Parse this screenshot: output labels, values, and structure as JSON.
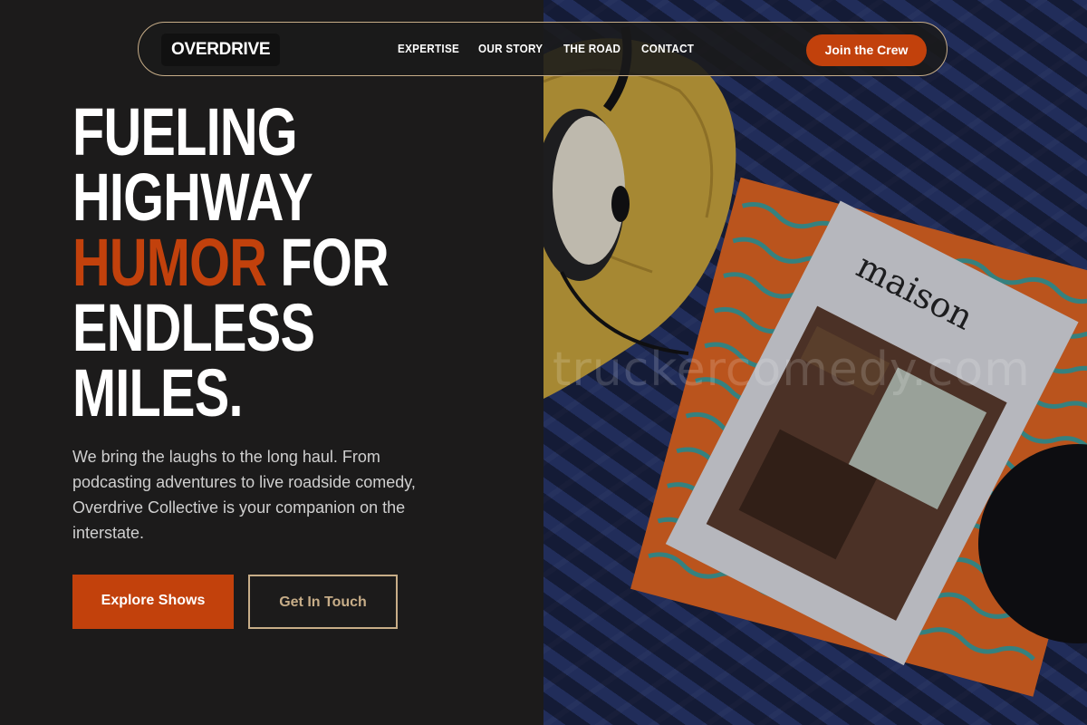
{
  "nav": {
    "logo": "OVERDRIVE",
    "links": [
      "EXPERTISE",
      "OUR STORY",
      "THE ROAD",
      "CONTACT"
    ],
    "cta": "Join the Crew"
  },
  "hero": {
    "title_line1": "FUELING",
    "title_line2": "HIGHWAY",
    "title_accent": "HUMOR",
    "title_line3_rest": " FOR",
    "title_line4": "ENDLESS",
    "title_line5": "MILES.",
    "description": "We bring the laughs to the long haul. From podcasting adventures to live roadside comedy, Overdrive Collective is your companion on the interstate.",
    "primary_button": "Explore Shows",
    "secondary_button": "Get In Touch"
  },
  "photo": {
    "magazine_title": "maison",
    "watermark": "truckercomedy.com"
  },
  "colors": {
    "accent": "#c2410c",
    "gold_border": "#c7ad88",
    "background": "#1c1b1b"
  }
}
